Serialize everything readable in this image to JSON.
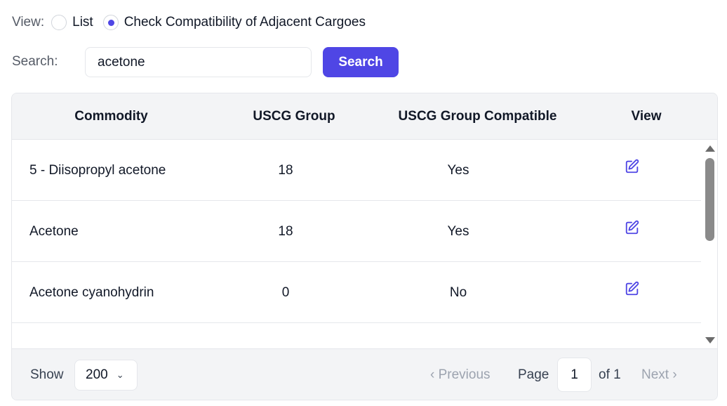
{
  "view": {
    "label": "View:",
    "options": [
      {
        "label": "List",
        "selected": false
      },
      {
        "label": "Check Compatibility of Adjacent Cargoes",
        "selected": true
      }
    ]
  },
  "search": {
    "label": "Search:",
    "value": "acetone",
    "button_label": "Search"
  },
  "table": {
    "headers": [
      "Commodity",
      "USCG Group",
      "USCG Group Compatible",
      "View"
    ],
    "rows": [
      {
        "commodity": "5 - Diisopropyl acetone",
        "group": "18",
        "compatible": "Yes",
        "view_icon": "edit-icon"
      },
      {
        "commodity": "Acetone",
        "group": "18",
        "compatible": "Yes",
        "view_icon": "edit-icon"
      },
      {
        "commodity": "Acetone cyanohydrin",
        "group": "0",
        "compatible": "No",
        "view_icon": "edit-icon"
      }
    ]
  },
  "footer": {
    "show_label": "Show",
    "page_size": "200",
    "prev_label": "‹ Previous",
    "page_label": "Page",
    "page_value": "1",
    "of_label": "of 1",
    "next_label": "Next ›"
  },
  "colors": {
    "accent": "#4f46e5",
    "header_bg": "#f3f4f6",
    "border": "#e5e7eb"
  }
}
